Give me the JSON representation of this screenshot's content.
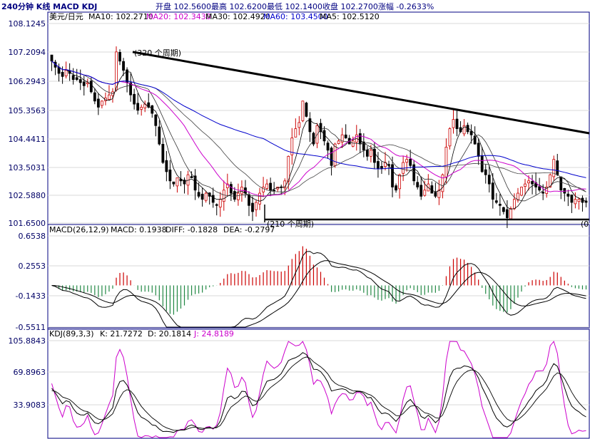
{
  "header": {
    "title": "240分钟 K线 MACD KDJ",
    "ohlc": "开盘 102.5600最高 102.6200最低 102.1400收盘 102.2700涨幅 -0.2633%"
  },
  "price_panel": {
    "instrument": "美元/日元",
    "ma_labels": [
      {
        "text": "MA10: 102.2710",
        "color": "#000000"
      },
      {
        "text": "MA20: 102.3430",
        "color": "#cc00cc"
      },
      {
        "text": "MA30: 102.4920",
        "color": "#000000"
      },
      {
        "text": "MA60: 103.4500",
        "color": "#0000cc"
      },
      {
        "text": "MA5: 102.5120",
        "color": "#000000"
      }
    ],
    "y_ticks": [
      "108.1245",
      "107.2094",
      "106.2943",
      "105.3563",
      "104.4411",
      "103.5031",
      "102.5880",
      "101.6500"
    ],
    "annotations": [
      "(320 个周期)",
      "(210 个周期)",
      "(0"
    ]
  },
  "macd_panel": {
    "labels": [
      {
        "text": "MACD(26,12,9)",
        "color": "#000000"
      },
      {
        "text": "MACD: 0.1938",
        "color": "#000000"
      },
      {
        "text": "DIFF: -0.1828",
        "color": "#000000"
      },
      {
        "text": "DEA: -0.2797",
        "color": "#000000"
      }
    ],
    "y_ticks": [
      "0.6538",
      "0.2553",
      "-0.1433",
      "-0.5511"
    ]
  },
  "kdj_panel": {
    "labels": [
      {
        "text": "KDJ(89,3,3)",
        "color": "#000000"
      },
      {
        "text": "K: 21.7272",
        "color": "#000000"
      },
      {
        "text": "D: 20.1814",
        "color": "#000000"
      },
      {
        "text": "J: 24.8189",
        "color": "#cc00cc"
      }
    ],
    "y_ticks": [
      "105.8843",
      "69.8963",
      "33.9083"
    ]
  },
  "chart_data": [
    {
      "type": "candlestick",
      "x_count": 150,
      "ylim": [
        101.65,
        108.1245
      ],
      "close_path": [
        106.9,
        106.7,
        106.5,
        106.4,
        106.6,
        106.5,
        106.3,
        106.3,
        106.2,
        106.1,
        106.2,
        105.9,
        105.6,
        105.4,
        105.6,
        105.7,
        105.8,
        105.9,
        107.2,
        106.9,
        106.6,
        106.2,
        105.8,
        105.5,
        105.3,
        105.4,
        105.5,
        105.4,
        105.2,
        104.8,
        104.2,
        103.6,
        103.3,
        103.0,
        102.9,
        103.1,
        103.0,
        102.9,
        103.2,
        103.1,
        102.7,
        102.5,
        102.4,
        102.6,
        102.5,
        102.3,
        102.2,
        102.4,
        102.7,
        102.9,
        102.6,
        102.4,
        102.6,
        102.8,
        102.6,
        102.2,
        102.0,
        102.3,
        102.6,
        102.8,
        102.9,
        102.7,
        102.7,
        102.8,
        102.8,
        103.0,
        103.8,
        104.4,
        104.7,
        104.9,
        105.6,
        105.1,
        104.6,
        104.2,
        104.8,
        104.6,
        104.3,
        104.0,
        103.5,
        104.2,
        104.3,
        104.5,
        104.4,
        104.2,
        104.3,
        104.5,
        104.2,
        104.0,
        103.8,
        104.0,
        103.6,
        103.4,
        103.4,
        103.6,
        103.5,
        102.8,
        102.7,
        103.2,
        103.6,
        103.7,
        103.5,
        103.0,
        102.8,
        102.5,
        102.7,
        102.9,
        102.6,
        102.5,
        102.7,
        103.2,
        104.1,
        104.7,
        105.0,
        104.7,
        104.6,
        104.8,
        104.6,
        104.5,
        104.2,
        103.8,
        103.3,
        103.2,
        102.9,
        102.4,
        102.3,
        102.2,
        102.0,
        101.8,
        102.1,
        102.4,
        102.6,
        102.8,
        102.9,
        103.0,
        102.9,
        102.8,
        102.7,
        102.6,
        102.8,
        103.2,
        103.7,
        103.2,
        102.7,
        102.6,
        102.5,
        102.3,
        102.4,
        102.4,
        102.3,
        102.3
      ],
      "moving_averages": [
        "MA10",
        "MA20",
        "MA30",
        "MA60",
        "MA5"
      ],
      "trend_lines": [
        "upper resistance line",
        "lower support line"
      ]
    },
    {
      "type": "bar",
      "series": [
        "MACD",
        "DIFF",
        "DEA"
      ],
      "ylim": [
        -0.5511,
        0.6538
      ]
    },
    {
      "type": "line",
      "series": [
        "K",
        "D",
        "J"
      ],
      "ylim": [
        0,
        105.8843
      ]
    }
  ]
}
